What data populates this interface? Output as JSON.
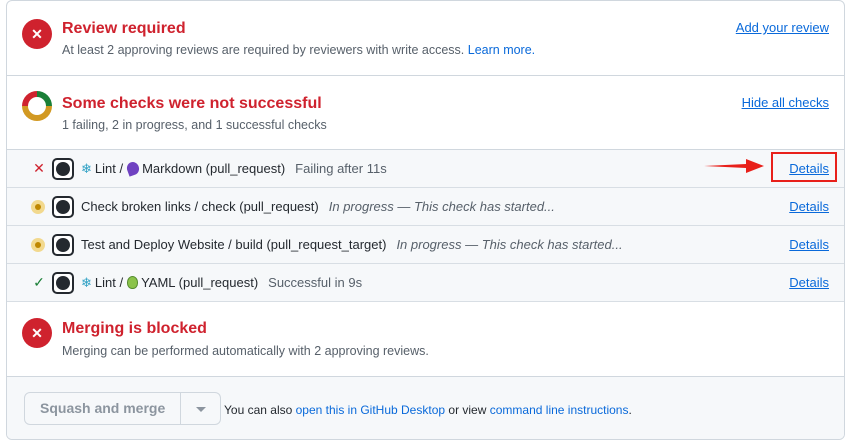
{
  "review": {
    "title": "Review required",
    "subtitle": "At least 2 approving reviews are required by reviewers with write access.",
    "learn_more": "Learn more.",
    "action": "Add your review"
  },
  "checks": {
    "title": "Some checks were not successful",
    "subtitle": "1 failing, 2 in progress, and 1 successful checks",
    "action": "Hide all checks",
    "rows": [
      {
        "prefix": "Lint /",
        "name": "Markdown (pull_request)",
        "status": "Failing after 11s",
        "state": "failing",
        "details": "Details"
      },
      {
        "prefix": "",
        "name": "Check broken links / check (pull_request)",
        "status": "In progress — This check has started...",
        "state": "in-progress",
        "details": "Details"
      },
      {
        "prefix": "",
        "name": "Test and Deploy Website / build (pull_request_target)",
        "status": "In progress — This check has started...",
        "state": "in-progress",
        "details": "Details"
      },
      {
        "prefix": "Lint /",
        "name": "YAML (pull_request)",
        "status": "Successful in 9s",
        "state": "success",
        "details": "Details"
      }
    ]
  },
  "merge": {
    "title": "Merging is blocked",
    "subtitle": "Merging can be performed automatically with 2 approving reviews."
  },
  "actions": {
    "button_label": "Squash and merge",
    "text_before": "You can also",
    "desktop_link": "open this in GitHub Desktop",
    "text_middle": "or view",
    "cli_link": "command line instructions",
    "text_end": "."
  },
  "colors": {
    "danger": "#cf222e",
    "success": "#1a7f37",
    "attention": "#bf8700",
    "link": "#0969da",
    "annotation": "#e8201a"
  },
  "icons": [
    "x-circle-icon",
    "checks-donut-icon",
    "github-avatar-icon",
    "snowflake-icon",
    "markdown-icon",
    "yaml-icon",
    "check-icon",
    "x-icon",
    "in-progress-icon",
    "caret-down-icon",
    "red-arrow-annotation"
  ]
}
